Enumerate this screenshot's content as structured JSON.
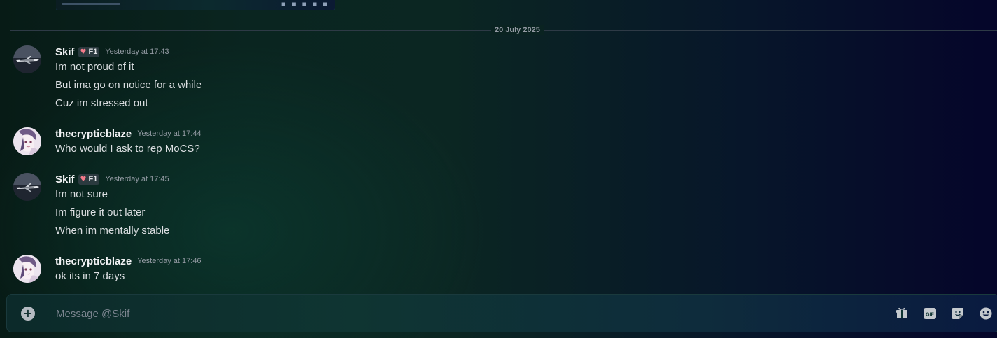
{
  "date_divider": "20 July 2025",
  "messages": [
    {
      "username": "Skif",
      "tag": "F1",
      "timestamp": "Yesterday at 17:43",
      "avatar": "plane-avatar",
      "lines": [
        "Im not proud of it",
        "But ima go on notice for a while",
        "Cuz im stressed out"
      ]
    },
    {
      "username": "thecrypticblaze",
      "timestamp": "Yesterday at 17:44",
      "avatar": "anime-avatar",
      "lines": [
        "Who would I ask to rep MoCS?"
      ]
    },
    {
      "username": "Skif",
      "tag": "F1",
      "timestamp": "Yesterday at 17:45",
      "avatar": "plane-avatar",
      "lines": [
        "Im not sure",
        "Im figure it out later",
        "When im mentally stable"
      ]
    },
    {
      "username": "thecrypticblaze",
      "timestamp": "Yesterday at 17:46",
      "avatar": "anime-avatar",
      "lines": [
        "ok its in 7 days"
      ]
    }
  ],
  "composer": {
    "placeholder": "Message @Skif",
    "gif_label": "GIF",
    "icons": [
      "add-attachment-icon",
      "gift-icon",
      "gif-icon",
      "sticker-icon",
      "emoji-icon"
    ]
  },
  "colors": {
    "tag_heart": "#f47b8a",
    "text": "#dbdee1",
    "muted": "#949ba4"
  }
}
